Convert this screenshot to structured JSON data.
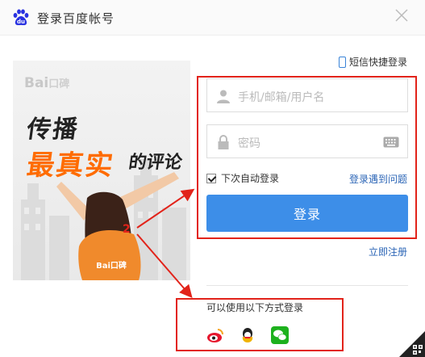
{
  "window": {
    "title": "登录百度帐号",
    "close_icon": "close-icon"
  },
  "banner": {
    "brand": "Bai",
    "brand_suffix": "口碑",
    "slogan_line1": "传播",
    "slogan_line2": "最真实",
    "slogan_line2b": "的评论",
    "shirt_text": "Bai口碑"
  },
  "login": {
    "sms_link": "短信快捷登录",
    "username_placeholder": "手机/邮箱/用户名",
    "password_placeholder": "密码",
    "remember_label": "下次自动登录",
    "remember_checked": true,
    "problem_link": "登录遇到问题",
    "login_button": "登录",
    "register_link": "立即注册"
  },
  "other_login": {
    "label": "可以使用以下方式登录",
    "providers": [
      "weibo-icon",
      "qq-icon",
      "wechat-icon"
    ]
  },
  "annotation": {
    "marker": "2"
  },
  "colors": {
    "primary_button": "#3d8ee8",
    "link": "#2b65b6",
    "annotation_red": "#e2231a",
    "banner_orange": "#ff6c00"
  }
}
